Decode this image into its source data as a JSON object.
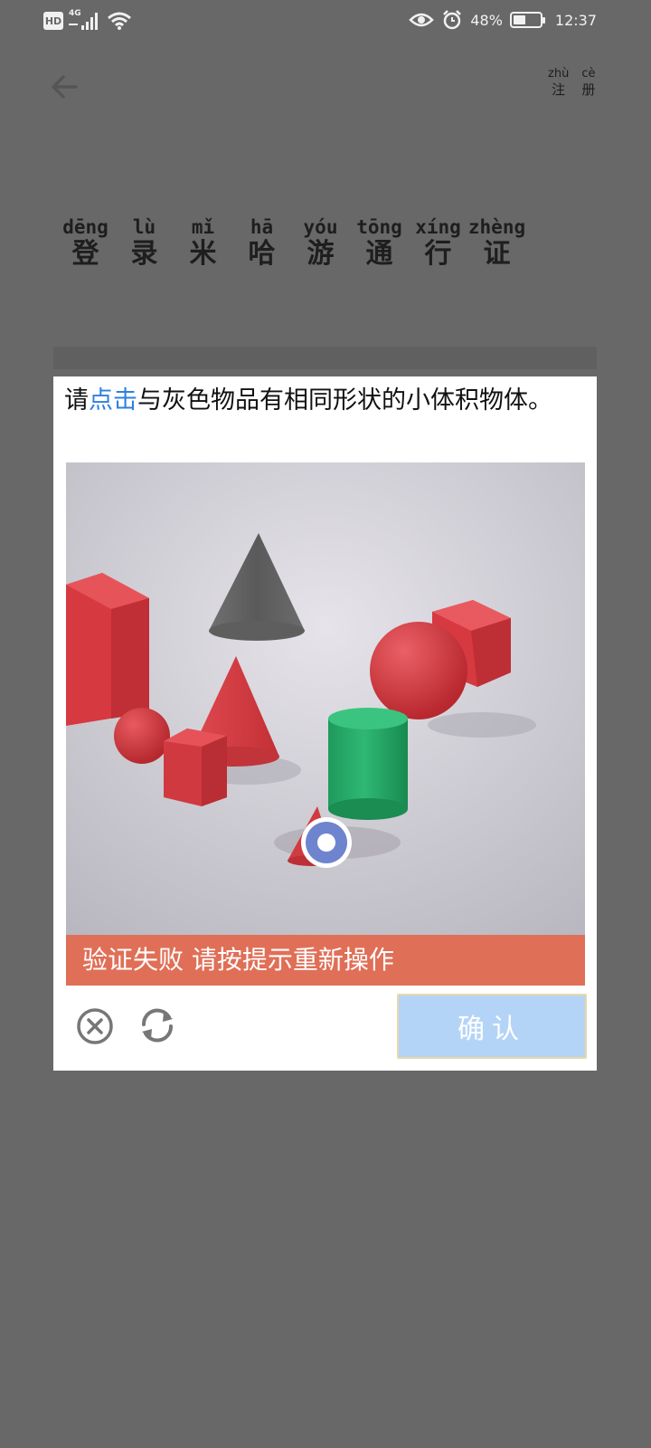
{
  "status_bar": {
    "hd_label": "HD",
    "network_label": "4G",
    "battery_percent": "48%",
    "battery_level": 0.48,
    "time": "12:37"
  },
  "header": {
    "register": [
      {
        "pinyin": "zhù",
        "hanzi": "注"
      },
      {
        "pinyin": "cè",
        "hanzi": "册"
      }
    ]
  },
  "title": [
    {
      "pinyin": "dēng",
      "hanzi": "登"
    },
    {
      "pinyin": "lù",
      "hanzi": "录"
    },
    {
      "pinyin": "mǐ",
      "hanzi": "米"
    },
    {
      "pinyin": "hā",
      "hanzi": "哈"
    },
    {
      "pinyin": "yóu",
      "hanzi": "游"
    },
    {
      "pinyin": "tōng",
      "hanzi": "通"
    },
    {
      "pinyin": "xíng",
      "hanzi": "行"
    },
    {
      "pinyin": "zhèng",
      "hanzi": "证"
    }
  ],
  "captcha": {
    "instruction_pre": "请",
    "instruction_highlight": "点击",
    "instruction_post": "与灰色物品有相同形状的小体积物体。",
    "error_message": "验证失败 请按提示重新操作",
    "confirm_label": "确认"
  },
  "colors": {
    "overlay": "#686868",
    "highlight": "#2f7fe0",
    "error": "#e06f57",
    "confirm": "#b4d4f7"
  }
}
